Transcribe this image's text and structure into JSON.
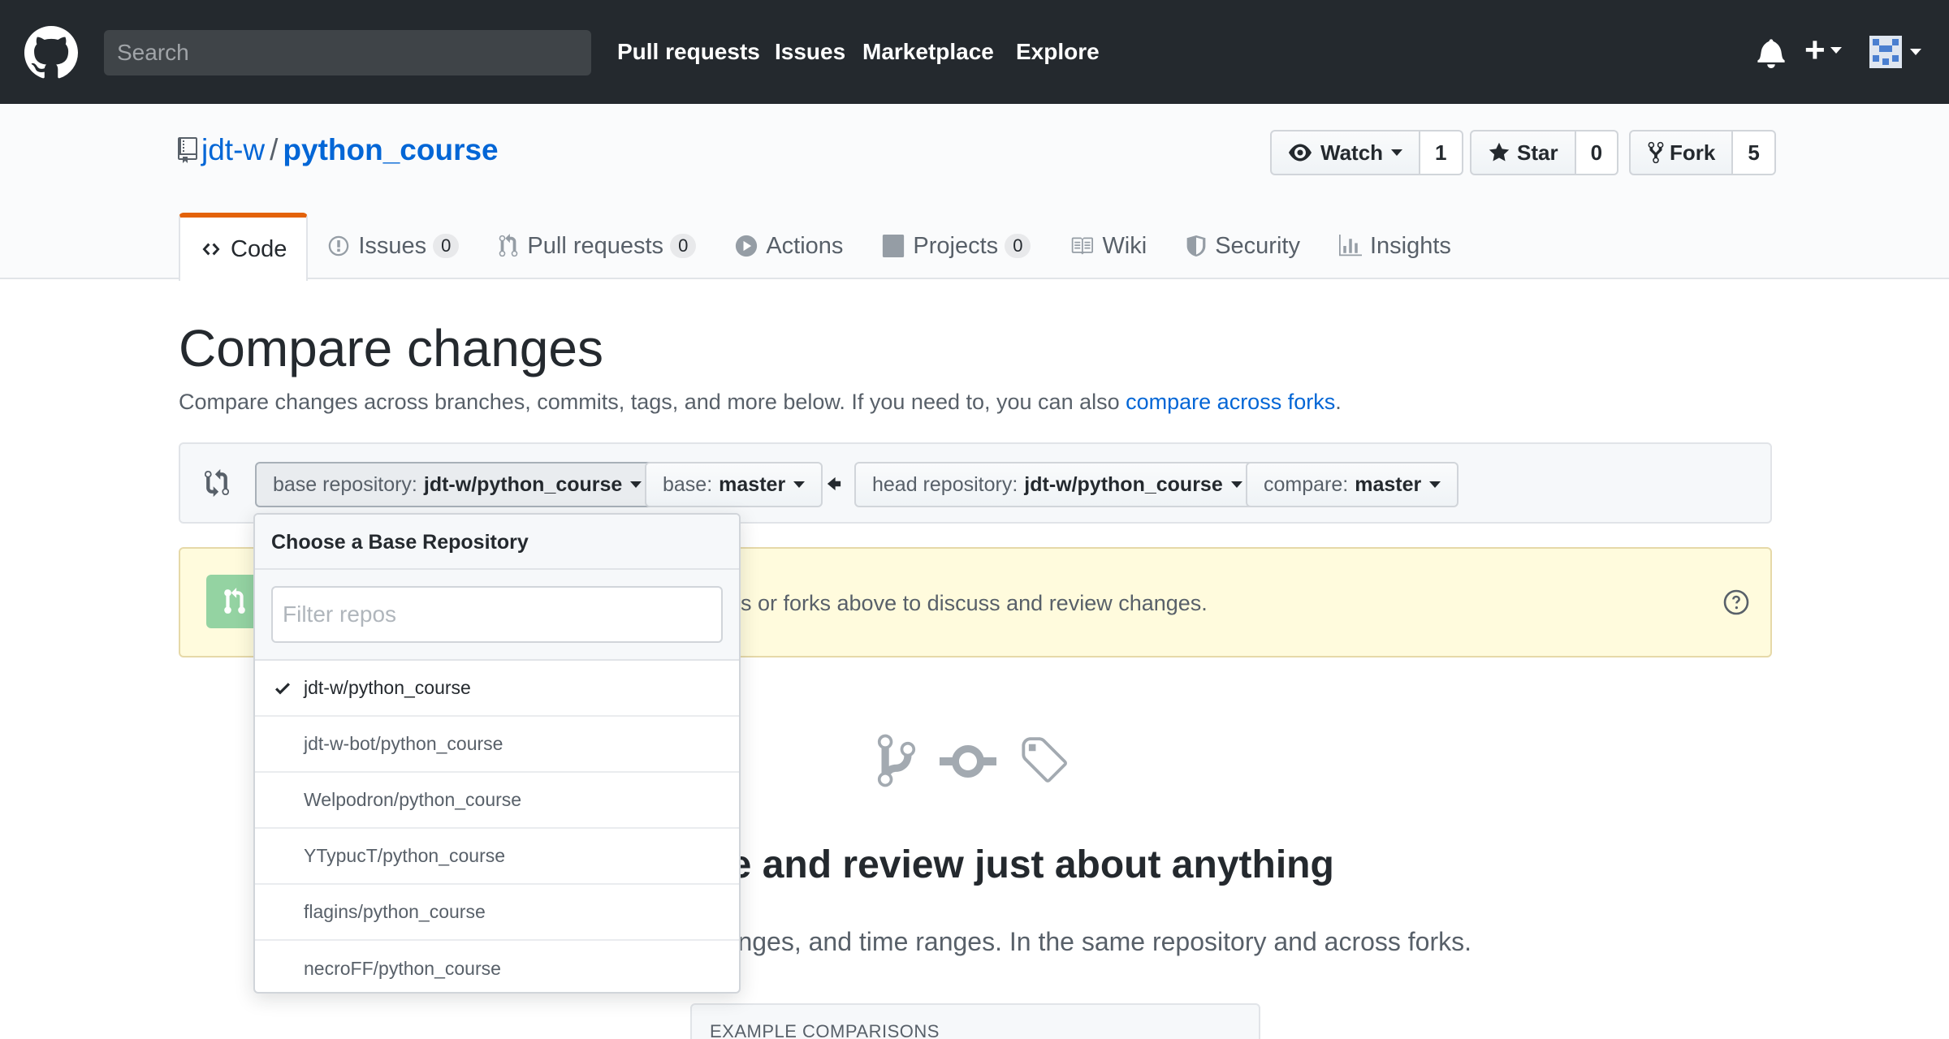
{
  "header": {
    "search_placeholder": "Search",
    "nav": [
      "Pull requests",
      "Issues",
      "Marketplace",
      "Explore"
    ],
    "plus_label": "+"
  },
  "repo": {
    "owner": "jdt-w",
    "separator": "/",
    "name": "python_course",
    "watch_label": "Watch",
    "watch_count": "1",
    "star_label": "Star",
    "star_count": "0",
    "fork_label": "Fork",
    "fork_count": "5"
  },
  "tabs": [
    {
      "label": "Code",
      "counter": "",
      "icon": "code-icon"
    },
    {
      "label": "Issues",
      "counter": "0",
      "icon": "issue-icon"
    },
    {
      "label": "Pull requests",
      "counter": "0",
      "icon": "pull-request-icon"
    },
    {
      "label": "Actions",
      "counter": "",
      "icon": "play-icon"
    },
    {
      "label": "Projects",
      "counter": "0",
      "icon": "project-icon"
    },
    {
      "label": "Wiki",
      "counter": "",
      "icon": "book-icon"
    },
    {
      "label": "Security",
      "counter": "",
      "icon": "shield-icon"
    },
    {
      "label": "Insights",
      "counter": "",
      "icon": "graph-icon"
    }
  ],
  "compare": {
    "title": "Compare changes",
    "desc_prefix": "Compare changes across branches, commits, tags, and more below. If you need to, you can also ",
    "desc_link": "compare across forks",
    "desc_suffix": ".",
    "base_repo_label": "base repository:",
    "base_repo_value": "jdt-w/python_course",
    "base_label": "base:",
    "base_value": "master",
    "head_repo_label": "head repository:",
    "head_repo_value": "jdt-w/python_course",
    "compare_label": "compare:",
    "compare_value": "master",
    "flash_text": "s or forks above to discuss and review changes.",
    "blank_title": "re and review just about anything",
    "blank_desc": "ranges, and time ranges. In the same repository and across forks.",
    "examples_header": "EXAMPLE COMPARISONS"
  },
  "dropdown": {
    "title": "Choose a Base Repository",
    "filter_placeholder": "Filter repos",
    "items": [
      "jdt-w/python_course",
      "jdt-w-bot/python_course",
      "Welpodron/python_course",
      "YTypucT/python_course",
      "flagins/python_course",
      "necroFF/python_course"
    ],
    "selected_index": 0
  },
  "colors": {
    "header_bg": "#24292e",
    "link": "#0366d6",
    "tab_accent": "#e36209",
    "flash_bg": "#fffbdd"
  }
}
